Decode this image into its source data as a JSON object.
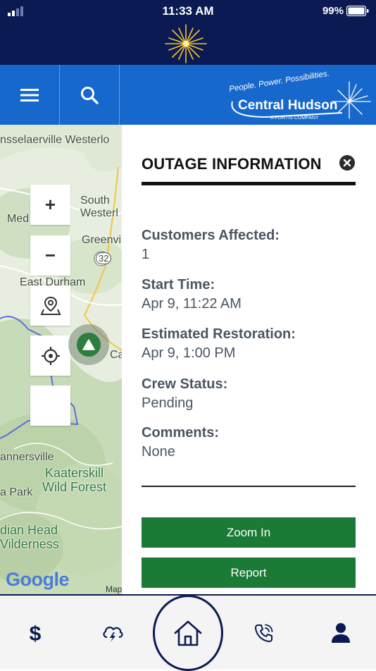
{
  "status_bar": {
    "time": "11:33 AM",
    "battery": "99%"
  },
  "map": {
    "labels": {
      "rensselaerville": "nsselaerville Westerlo",
      "south_westerlo": "South\nWesterl",
      "medusa": "Med",
      "greenville": "Greenvi",
      "route": "32",
      "east_durham": "East Durham",
      "cairo": "Ca",
      "tannersville": "annersville",
      "kaaterskill": "Kaaterskill\nWild Forest",
      "park": "a Park",
      "indian_head": "dian Head\nVilderness",
      "map_link": "Map"
    },
    "zoom_in_glyph": "+",
    "zoom_out_glyph": "−"
  },
  "panel": {
    "title": "OUTAGE INFORMATION",
    "fields": [
      {
        "label": "Customers Affected:",
        "value": "1"
      },
      {
        "label": "Start Time:",
        "value": "Apr 9, 11:22 AM"
      },
      {
        "label": "Estimated Restoration:",
        "value": "Apr 9, 1:00 PM"
      },
      {
        "label": "Crew Status:",
        "value": "Pending"
      },
      {
        "label": "Comments:",
        "value": "None"
      }
    ],
    "zoom_in_label": "Zoom In",
    "report_label": "Report"
  },
  "brand": {
    "tagline": "People. Power. Possibilities.",
    "name": "Central Hudson",
    "sub": "A FORTIS COMPANY",
    "google": "Google"
  },
  "tabs": [
    "billing-icon",
    "storm-icon",
    "home-icon",
    "phone-icon",
    "account-icon"
  ],
  "colors": {
    "navy": "#0b1a52",
    "blue": "#1668cc",
    "green": "#1a7a36"
  }
}
